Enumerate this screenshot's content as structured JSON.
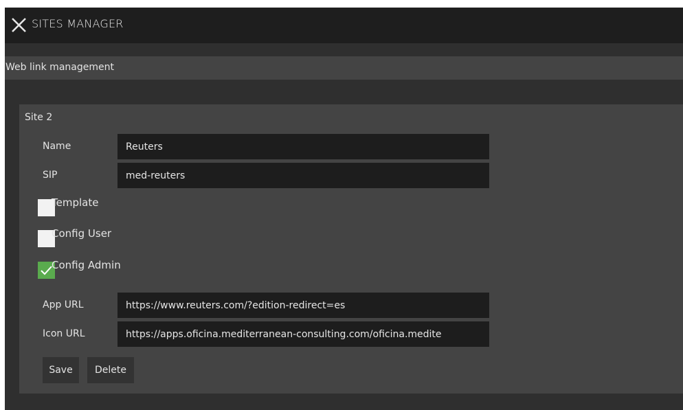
{
  "window": {
    "title": "SITES MANAGER"
  },
  "subheader": {
    "label": "Web link management"
  },
  "site": {
    "title": "Site 2",
    "fields": {
      "name": {
        "label": "Name",
        "value": "Reuters"
      },
      "sip": {
        "label": "SIP",
        "value": "med-reuters"
      },
      "app_url": {
        "label": "App URL",
        "value": "https://www.reuters.com/?edition-redirect=es"
      },
      "icon_url": {
        "label": "Icon URL",
        "value": "https://apps.oficina.mediterranean-consulting.com/oficina.medite"
      }
    },
    "checkboxes": [
      {
        "label": "Template",
        "checked": false
      },
      {
        "label": "Config User",
        "checked": false
      },
      {
        "label": "Config Admin",
        "checked": true
      }
    ],
    "buttons": {
      "save": "Save",
      "delete": "Delete"
    }
  },
  "colors": {
    "checked": "#5aab4e",
    "panel": "#444444",
    "input": "#1d1d1d",
    "titlebar": "#1e1e1e"
  },
  "icons": {
    "close": "close-x-icon",
    "check": "checkmark-icon"
  }
}
